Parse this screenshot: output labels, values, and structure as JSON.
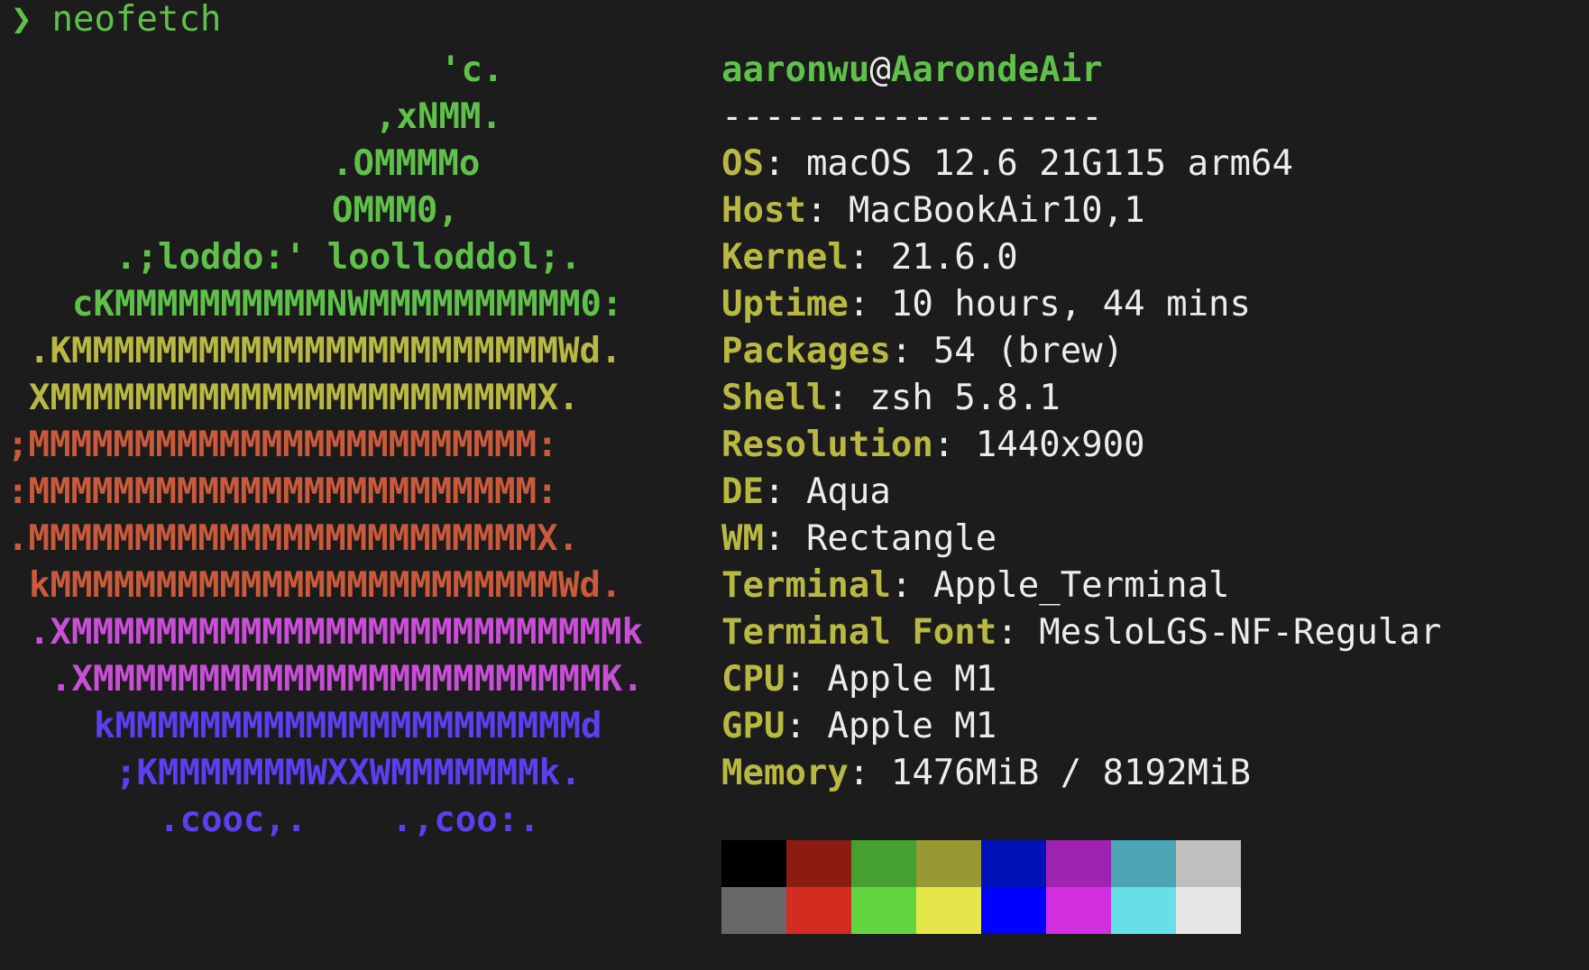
{
  "prompt": {
    "symbol": "❯",
    "command": "neofetch"
  },
  "logo": {
    "lines": [
      {
        "text": "'c.",
        "color": "#5fc14a"
      },
      {
        "text": ",xNMM.",
        "color": "#5fc14a"
      },
      {
        "text": ".OMMMMo",
        "color": "#5fc14a"
      },
      {
        "text": "OMMM0,",
        "color": "#5fc14a"
      },
      {
        "text": ".;loddo:' loolloddol;.",
        "color": "#5fc14a"
      },
      {
        "text": "cKMMMMMMMMMMNWMMMMMMMMMM0:",
        "color": "#5fc14a"
      },
      {
        "text": ".KMMMMMMMMMMMMMMMMMMMMMMMWd.",
        "color": "#b8b842"
      },
      {
        "text": "XMMMMMMMMMMMMMMMMMMMMMMMX.",
        "color": "#b8b842"
      },
      {
        "text": ";MMMMMMMMMMMMMMMMMMMMMMMM:",
        "color": "#c95a3c"
      },
      {
        "text": ":MMMMMMMMMMMMMMMMMMMMMMMM:",
        "color": "#c95a3c"
      },
      {
        "text": ".MMMMMMMMMMMMMMMMMMMMMMMMX.",
        "color": "#c95a3c"
      },
      {
        "text": "kMMMMMMMMMMMMMMMMMMMMMMMMWd.",
        "color": "#c95a3c"
      },
      {
        "text": ".XMMMMMMMMMMMMMMMMMMMMMMMMMMk",
        "color": "#c84fd6"
      },
      {
        "text": ".XMMMMMMMMMMMMMMMMMMMMMMMMK.",
        "color": "#c84fd6"
      },
      {
        "text": "kMMMMMMMMMMMMMMMMMMMMMMd",
        "color": "#5b3ff0"
      },
      {
        "text": ";KMMMMMMMWXXWMMMMMMMk.",
        "color": "#5b3ff0"
      },
      {
        "text": ".cooc,.    .,coo:.",
        "color": "#5b3ff0"
      }
    ]
  },
  "info": {
    "user": "aaronwu",
    "at": "@",
    "host": "AarondeAir",
    "separator": "------------------",
    "fields": [
      {
        "key": "OS",
        "value": "macOS 12.6 21G115 arm64"
      },
      {
        "key": "Host",
        "value": "MacBookAir10,1"
      },
      {
        "key": "Kernel",
        "value": "21.6.0"
      },
      {
        "key": "Uptime",
        "value": "10 hours, 44 mins"
      },
      {
        "key": "Packages",
        "value": "54 (brew)"
      },
      {
        "key": "Shell",
        "value": "zsh 5.8.1"
      },
      {
        "key": "Resolution",
        "value": "1440x900"
      },
      {
        "key": "DE",
        "value": "Aqua"
      },
      {
        "key": "WM",
        "value": "Rectangle"
      },
      {
        "key": "Terminal",
        "value": "Apple_Terminal"
      },
      {
        "key": "Terminal Font",
        "value": "MesloLGS-NF-Regular"
      },
      {
        "key": "CPU",
        "value": "Apple M1"
      },
      {
        "key": "GPU",
        "value": "Apple M1"
      },
      {
        "key": "Memory",
        "value": "1476MiB / 8192MiB"
      }
    ]
  },
  "palette": {
    "normal": [
      "#000000",
      "#8c1c12",
      "#45a12f",
      "#999933",
      "#0011b8",
      "#a022b0",
      "#4aa4b4",
      "#bfbfbf"
    ],
    "bright": [
      "#686868",
      "#d32d21",
      "#62d63f",
      "#e6e64a",
      "#0000ff",
      "#d12ee0",
      "#66e0e6",
      "#e6e6e6"
    ]
  }
}
